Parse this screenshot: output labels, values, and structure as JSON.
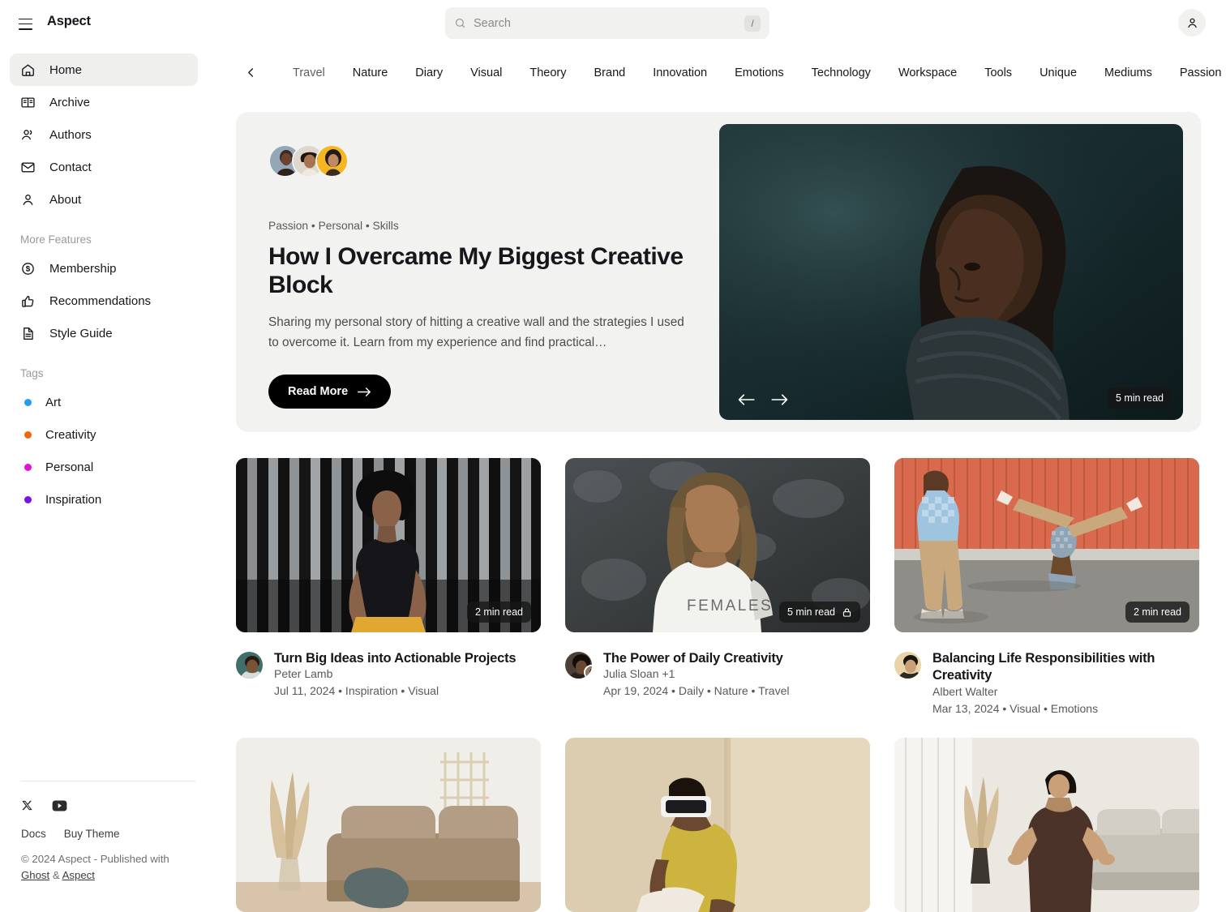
{
  "header": {
    "brand": "Aspect",
    "menu_icon": "hamburger-icon",
    "search": {
      "placeholder": "Search",
      "value": "",
      "shortcut": "/"
    },
    "account_icon": "user-icon"
  },
  "sidebar": {
    "nav": [
      {
        "label": "Home",
        "icon": "home-icon",
        "active": true
      },
      {
        "label": "Archive",
        "icon": "book-icon",
        "active": false
      },
      {
        "label": "Authors",
        "icon": "users-icon",
        "active": false
      },
      {
        "label": "Contact",
        "icon": "mail-icon",
        "active": false
      },
      {
        "label": "About",
        "icon": "person-icon",
        "active": false
      }
    ],
    "more_features_label": "More Features",
    "features": [
      {
        "label": "Membership",
        "icon": "dollar-circle-icon"
      },
      {
        "label": "Recommendations",
        "icon": "thumbs-up-icon"
      },
      {
        "label": "Style Guide",
        "icon": "document-icon"
      }
    ],
    "tags_label": "Tags",
    "tags": [
      {
        "label": "Art",
        "color": "#21a0f0"
      },
      {
        "label": "Creativity",
        "color": "#f0660f"
      },
      {
        "label": "Personal",
        "color": "#e612d6"
      },
      {
        "label": "Inspiration",
        "color": "#7a13e0"
      }
    ],
    "footer": {
      "social": [
        {
          "name": "x-icon"
        },
        {
          "name": "youtube-icon"
        }
      ],
      "links": [
        "Docs",
        "Buy Theme"
      ],
      "copyright_pre": "© 2024 Aspect - Published with ",
      "copyright_link1": "Ghost",
      "copyright_amp": " & ",
      "copyright_link2": "Aspect"
    }
  },
  "tagnav": {
    "prev_icon": "chevron-left-icon",
    "items": [
      "Travel",
      "Nature",
      "Diary",
      "Visual",
      "Theory",
      "Brand",
      "Innovation",
      "Emotions",
      "Technology",
      "Workspace",
      "Tools",
      "Unique",
      "Mediums",
      "Passion"
    ]
  },
  "hero": {
    "tags": "Passion  •  Personal  •  Skills",
    "title": "How I Overcame My Biggest Creative Block",
    "excerpt": "Sharing my personal story of hitting a creative wall and the strategies I used to overcome it. Learn from my experience and find practical…",
    "read_more": "Read More",
    "read_more_icon": "arrow-right-icon",
    "read_time": "5 min read",
    "prev_icon": "arrow-left-icon",
    "next_icon": "arrow-right-icon",
    "avatar_count": 3
  },
  "cards": [
    {
      "title": "Turn Big Ideas into Actionable Projects",
      "author": "Peter Lamb",
      "extra_authors": "",
      "meta": "Jul 11, 2024  •  Inspiration  •  Visual",
      "read_time": "2 min read",
      "locked": false,
      "badge_theme": "dark"
    },
    {
      "title": "The Power of Daily Creativity",
      "author": "Julia Sloan",
      "extra_authors": "+1",
      "meta": "Apr 19, 2024  •  Daily  •  Nature  •  Travel",
      "read_time": "5 min read",
      "locked": true,
      "lock_icon": "lock-icon",
      "badge_theme": "dark"
    },
    {
      "title": "Balancing Life Responsibilities with Creativity",
      "author": "Albert Walter",
      "extra_authors": "",
      "meta": "Mar 13, 2024  •  Visual  •  Emotions",
      "read_time": "2 min read",
      "locked": false,
      "badge_theme": "dark"
    }
  ],
  "cards_row2": [
    {
      "alt": "living-room-with-sofa-and-pampas-grass"
    },
    {
      "alt": "person-wearing-vr-headset-seated"
    },
    {
      "alt": "woman-meditating-in-living-room"
    }
  ]
}
